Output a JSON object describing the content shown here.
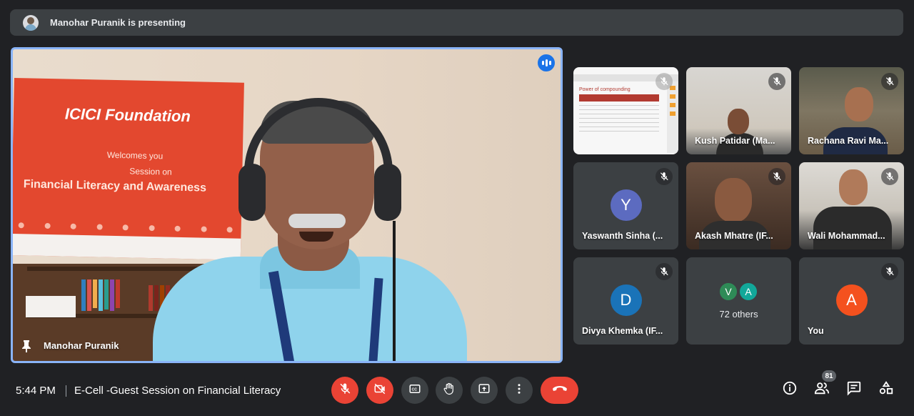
{
  "presenting_banner": {
    "text": "Manohar Puranik is presenting"
  },
  "main_stage": {
    "participant_name": "Manohar Puranik",
    "banner_logo": "ICICI Foundation",
    "banner_line1": "Welcomes you",
    "banner_line2": "Session on",
    "banner_line3": "Financial Literacy and Awareness"
  },
  "participants": [
    {
      "name": "Manohar Puranik",
      "type": "screen-share",
      "sheet_title": "Power of compounding"
    },
    {
      "name": "Kush Patidar (Ma...",
      "type": "video"
    },
    {
      "name": "Rachana Ravi Ma...",
      "type": "video"
    },
    {
      "name": "Yaswanth Sinha (...",
      "type": "avatar",
      "initial": "Y",
      "color": "#5c6bc0"
    },
    {
      "name": "Akash Mhatre (IF...",
      "type": "video"
    },
    {
      "name": "Wali Mohammad...",
      "type": "video"
    },
    {
      "name": "Divya Khemka (IF...",
      "type": "avatar",
      "initial": "D",
      "color": "#1a73b8"
    },
    {
      "name": "You",
      "type": "avatar",
      "initial": "A",
      "color": "#f4511e"
    }
  ],
  "others_tile": {
    "count_label": "72 others",
    "avatars": [
      {
        "initial": "V",
        "color": "#2e8b57"
      },
      {
        "initial": "A",
        "color": "#12a89a"
      }
    ]
  },
  "bottom_bar": {
    "time": "5:44 PM",
    "meeting_title": "E-Cell -Guest Session on Financial Literacy",
    "people_count": "81"
  },
  "icons": [
    "pin-icon",
    "audio-level-icon",
    "mic-off-icon",
    "camera-off-icon",
    "captions-icon",
    "raise-hand-icon",
    "present-screen-icon",
    "more-options-icon",
    "hang-up-icon",
    "info-icon",
    "people-icon",
    "chat-icon",
    "activities-icon"
  ],
  "colors": {
    "background": "#202124",
    "tile": "#3c4043",
    "accent_blue": "#8ab4f8",
    "red": "#ea4335"
  }
}
